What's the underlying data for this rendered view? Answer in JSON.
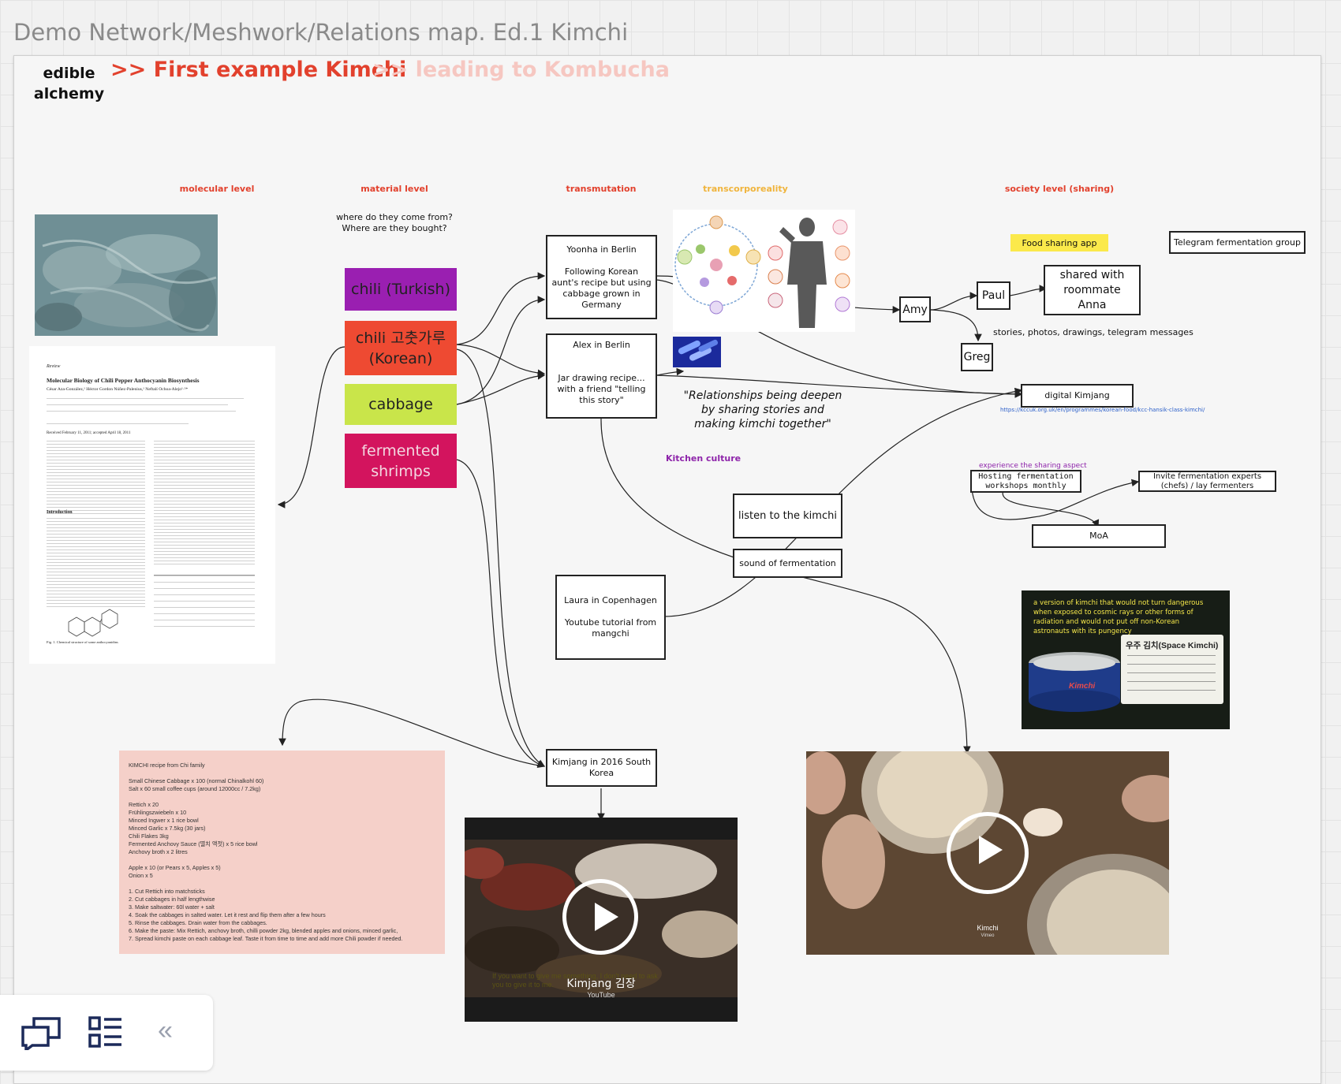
{
  "board": {
    "title": "Demo Network/Meshwork/Relations map. Ed.1 Kimchi",
    "brand": "edible alchemy",
    "headline_primary": ">> First example Kimchi",
    "headline_secondary": ">> leading to Kombucha"
  },
  "columns": [
    {
      "label": "molecular level",
      "color": "#e2412d"
    },
    {
      "label": "material level",
      "color": "#e2412d"
    },
    {
      "label": "transmutation",
      "color": "#e2412d"
    },
    {
      "label": "transcorporeality",
      "color": "#f0b43c"
    },
    {
      "label": "society level (sharing)",
      "color": "#e2412d"
    }
  ],
  "material_question": "where do they come from?\nWhere are they bought?",
  "ingredients": [
    {
      "label": "chili (Turkish)",
      "color": "#9a1fb1"
    },
    {
      "label": "chili 고춧가루\n(Korean)",
      "color": "#ee4a32"
    },
    {
      "label": "cabbage",
      "color": "#c9e54a"
    },
    {
      "label": "fermented\nshrimps",
      "color": "#d3145e"
    }
  ],
  "nodes": {
    "yoonha": {
      "title": "Yoonha in Berlin",
      "body": "Following Korean aunt's recipe but using cabbage grown in Germany"
    },
    "alex": {
      "title": "Alex in Berlin",
      "body": "Jar drawing recipe...\nwith a friend \"telling this story\""
    },
    "laura": {
      "title": "Laura in Copenhagen",
      "body": "Youtube tutorial from mangchi"
    },
    "kimjang": {
      "title": "Kimjang in 2016  South Korea"
    },
    "amy": "Amy",
    "paul": "Paul",
    "greg": "Greg",
    "shared": "shared with roommate Anna",
    "telegram": "Telegram fermentation group",
    "food_app": "Food sharing app",
    "digital_kimjang": "digital Kimjang",
    "listen": "listen to the kimchi",
    "sound": "sound of fermentation",
    "workshops": "Hosting fermentation workshops monthly",
    "experts": "Invite fermentation experts (chefs) / lay fermenters",
    "moa": "MoA"
  },
  "labels": {
    "stories": "stories, photos, drawings, telegram messages",
    "quote": "\"Relationships being deepen by sharing stories and making kimchi together\"",
    "kitchen_culture": "Kitchen culture",
    "experience": "experience the sharing aspect",
    "link": "https://kccuk.org.uk/en/programmes/korean-food/kcc-hansik-class-kimchi/"
  },
  "space_kimchi": {
    "caption": "a version of kimchi that would not turn dangerous when exposed to cosmic rays or other forms of radiation and would not put off non-Korean astronauts with its pungency",
    "sign": "우주 김치(Space Kimchi)",
    "can_label": "Kimchi"
  },
  "paper": {
    "section": "Review",
    "title": "Molecular Biology of Chili Pepper Anthocyanin Biosynthesis",
    "authors": "César Aza-González,¹ Héctor Gordon Núñez-Palenius,¹ Neftalí Ochoa-Alejo¹·²*",
    "received": "Received February 11, 2011; accepted April 18, 2011",
    "introduction": "Introduction",
    "figure": "Fig. 1. Chemical structure of some anthocyanidins"
  },
  "recipe": {
    "title": "KIMCHI recipe from Chi family",
    "base": "Small Chinese Cabbage x 100 (normal Chinalkohl 60)\nSalt x 60 small coffee cups (around 12000cc / 7.2kg)",
    "paste": "Rettich x 20\nFrühlingszwiebeln x 10\nMinced Ingwer x 1 rice bowl\nMinced Garlic x 7.5kg (30 jars)\nChili Flakes 3kg\nFermented Anchovy Sauce (멸치 액젓) x 5 rice bowl\nAnchovy  broth x 2 litres",
    "fruit": "Apple x 10 (or Pears x 5, Apples x 5)\nOnion x 5",
    "steps": [
      "1.      Cut Rettich into matchsticks",
      "2.      Cut cabbages in half lengthwise",
      "3.      Make saltwater: 60l water + salt",
      "4.      Soak the cabbages in salted water. Let it rest and flip them after a few hours",
      "5.      Rinse the cabbages. Drain water from the cabbages.",
      "6.      Make the paste: Mix Rettich, anchovy broth, chilli powder 2kg, blended apples and onions, minced garlic,",
      "7.      Spread kimchi paste on each cabbage leaf. Taste it from time to time and add more Chili powder if needed."
    ]
  },
  "videos": [
    {
      "title": "Kimjang 김장",
      "source": "YouTube",
      "subtitle": "If you want to give me something, I don't need to ask\nyou to give it to me."
    },
    {
      "title": "Kimchi",
      "source": "Vimeo"
    }
  ],
  "toolbar": {
    "collapse_glyph": "«"
  }
}
